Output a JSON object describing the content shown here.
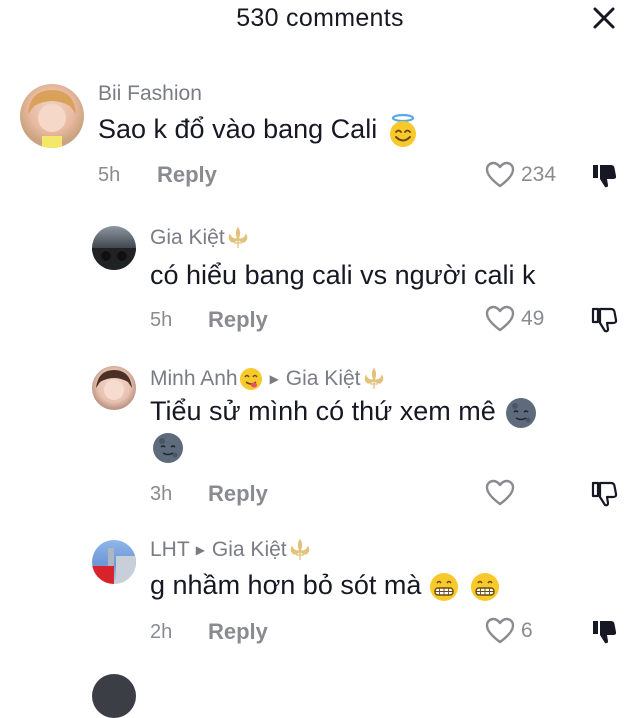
{
  "header": {
    "title": "530 comments",
    "close_icon": "close-icon"
  },
  "comments": [
    {
      "author": "Bii Fashion",
      "text": "Sao k đổ vào bang Cali",
      "emoji": "halo-smile-emoji",
      "time": "5h",
      "reply_label": "Reply",
      "likes": "234",
      "disliked": true
    },
    {
      "author": "Gia Kiệt",
      "text": "có hiểu bang cali vs người cali k",
      "time": "5h",
      "reply_label": "Reply",
      "likes": "49",
      "disliked": false
    },
    {
      "author": "Minh Anh",
      "reply_to": "Gia Kiệt",
      "text_line1": "Tiểu sử mình có thứ xem mê",
      "emoji": "moon-face-emoji",
      "time": "3h",
      "reply_label": "Reply",
      "likes": "",
      "disliked": false
    },
    {
      "author": "LHT",
      "reply_to": "Gia Kiệt",
      "text": "g nhầm hơn bỏ sót mà",
      "emoji": "grin-emoji",
      "time": "2h",
      "reply_label": "Reply",
      "likes": "6",
      "disliked": true
    }
  ],
  "colors": {
    "text": "#161823",
    "muted": "#8a8b91",
    "gold": "#e2c27a"
  }
}
